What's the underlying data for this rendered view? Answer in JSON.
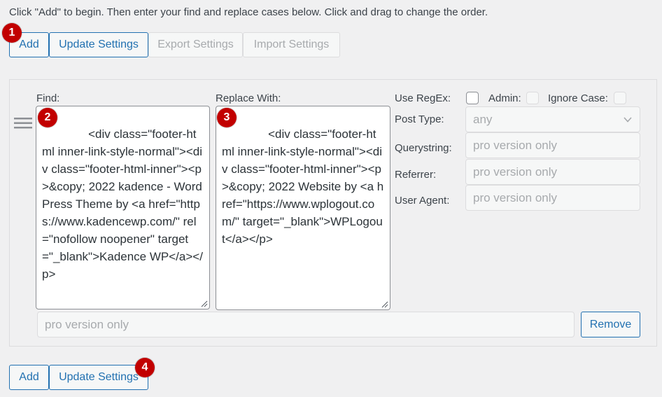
{
  "instructions": "Click \"Add\" to begin. Then enter your find and replace cases below. Click and drag to change the order.",
  "top_toolbar": {
    "add_label": "Add",
    "update_label": "Update Settings",
    "export_label": "Export Settings",
    "import_label": "Import Settings"
  },
  "badges": {
    "b1": "1",
    "b2": "2",
    "b3": "3",
    "b4": "4"
  },
  "rule": {
    "find_label": "Find:",
    "find_value": "            <div class=\"footer-html inner-link-style-normal\"><div class=\"footer-html-inner\"><p>&copy; 2022 kadence - WordPress Theme by <a href=\"https://www.kadencewp.com/\" rel=\"nofollow noopener\" target=\"_blank\">Kadence WP</a></p>",
    "replace_label": "Replace With:",
    "replace_value": "            <div class=\"footer-html inner-link-style-normal\"><div class=\"footer-html-inner\"><p>&copy; 2022 Website by <a href=\"https://www.wplogout.com/\" target=\"_blank\">WPLogout</a></p>",
    "use_regex_label": "Use RegEx:",
    "admin_label": "Admin:",
    "ignore_case_label": "Ignore Case:",
    "post_type_label": "Post Type:",
    "post_type_value": "any",
    "querystring_label": "Querystring:",
    "querystring_placeholder": "pro version only",
    "referrer_label": "Referrer:",
    "referrer_placeholder": "pro version only",
    "user_agent_label": "User Agent:",
    "user_agent_placeholder": "pro version only",
    "bottom_field_placeholder": "pro version only",
    "remove_label": "Remove"
  },
  "bottom_toolbar": {
    "add_label": "Add",
    "update_label": "Update Settings"
  },
  "colors": {
    "accent": "#2271b1",
    "badge": "#c20000",
    "disabled_text": "#a7aaad",
    "background": "#f0f0f1"
  },
  "icons": {
    "drag": "drag-handle-icon",
    "chevron": "chevron-down-icon",
    "resize": "resize-grip-icon"
  }
}
